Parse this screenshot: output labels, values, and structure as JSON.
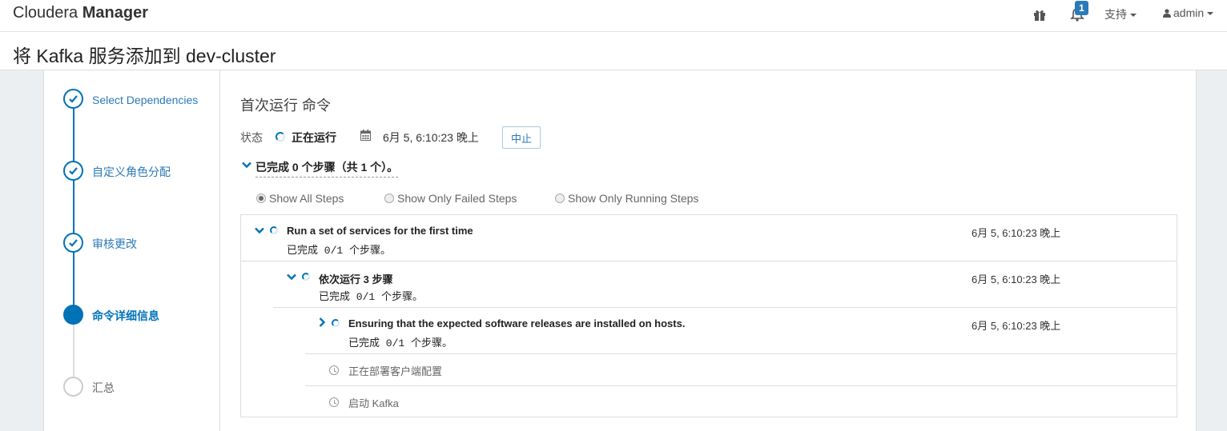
{
  "header": {
    "brand_light": "Cloudera",
    "brand_bold": "Manager",
    "notification_count": "1",
    "support_label": "支持",
    "user_label": "admin"
  },
  "page": {
    "title": "将 Kafka 服务添加到 dev-cluster"
  },
  "wizard": {
    "steps": [
      {
        "label": "Select Dependencies",
        "state": "done"
      },
      {
        "label": "自定义角色分配",
        "state": "done"
      },
      {
        "label": "审核更改",
        "state": "done"
      },
      {
        "label": "命令详细信息",
        "state": "active"
      },
      {
        "label": "汇总",
        "state": "pending"
      }
    ]
  },
  "command": {
    "title": "首次运行 命令",
    "status_label": "状态",
    "status_value": "正在运行",
    "status_time": "6月 5, 6:10:23 晚上",
    "abort_label": "中止",
    "summary": "已完成 0 个步骤（共 1 个）。"
  },
  "filters": {
    "all": "Show All Steps",
    "failed": "Show Only Failed Steps",
    "running": "Show Only Running Steps",
    "selected": "all"
  },
  "steps": [
    {
      "name": "Run a set of services for the first time",
      "progress": "已完成 0/1 个步骤。",
      "time": "6月 5, 6:10:23 晚上"
    },
    {
      "name": "依次运行 3 步骤",
      "progress": "已完成 0/1 个步骤。",
      "time": "6月 5, 6:10:23 晚上"
    },
    {
      "name": "Ensuring that the expected software releases are installed on hosts.",
      "progress": "已完成 0/1 个步骤。",
      "time": "6月 5, 6:10:23 晚上"
    },
    {
      "name": "正在部署客户端配置"
    },
    {
      "name": "启动 Kafka"
    }
  ],
  "colors": {
    "accent": "#0073b7",
    "link": "#2b7ab8",
    "badge": "#2b7ab8"
  }
}
